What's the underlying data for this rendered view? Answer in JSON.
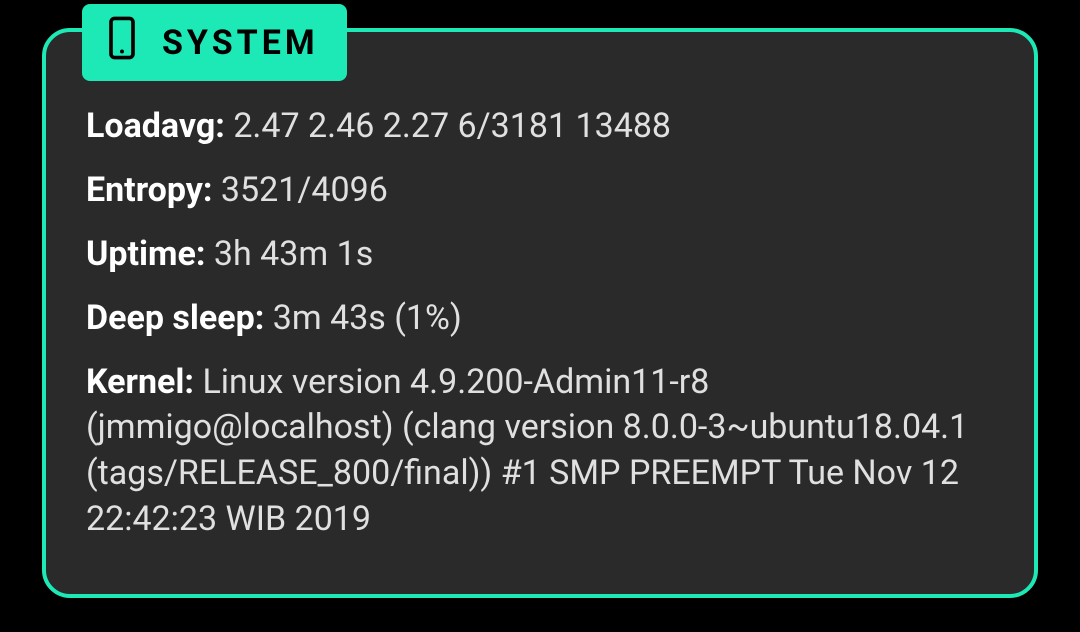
{
  "panel": {
    "title": "SYSTEM",
    "accent_color": "#1de9b6",
    "bg_color": "#2a2a2a",
    "rows": [
      {
        "label": "Loadavg:",
        "value": "2.47 2.46 2.27 6/3181 13488"
      },
      {
        "label": "Entropy:",
        "value": "3521/4096"
      },
      {
        "label": "Uptime:",
        "value": "3h 43m 1s"
      },
      {
        "label": "Deep sleep:",
        "value": "3m 43s  (1%)"
      },
      {
        "label": "Kernel:",
        "value": "Linux version 4.9.200-Admin11-r8 (jmmigo@localhost) (clang version 8.0.0-3~ubuntu18.04.1 (tags/RELEASE_800/final)) #1 SMP PREEMPT Tue Nov 12 22:42:23 WIB 2019"
      }
    ]
  }
}
